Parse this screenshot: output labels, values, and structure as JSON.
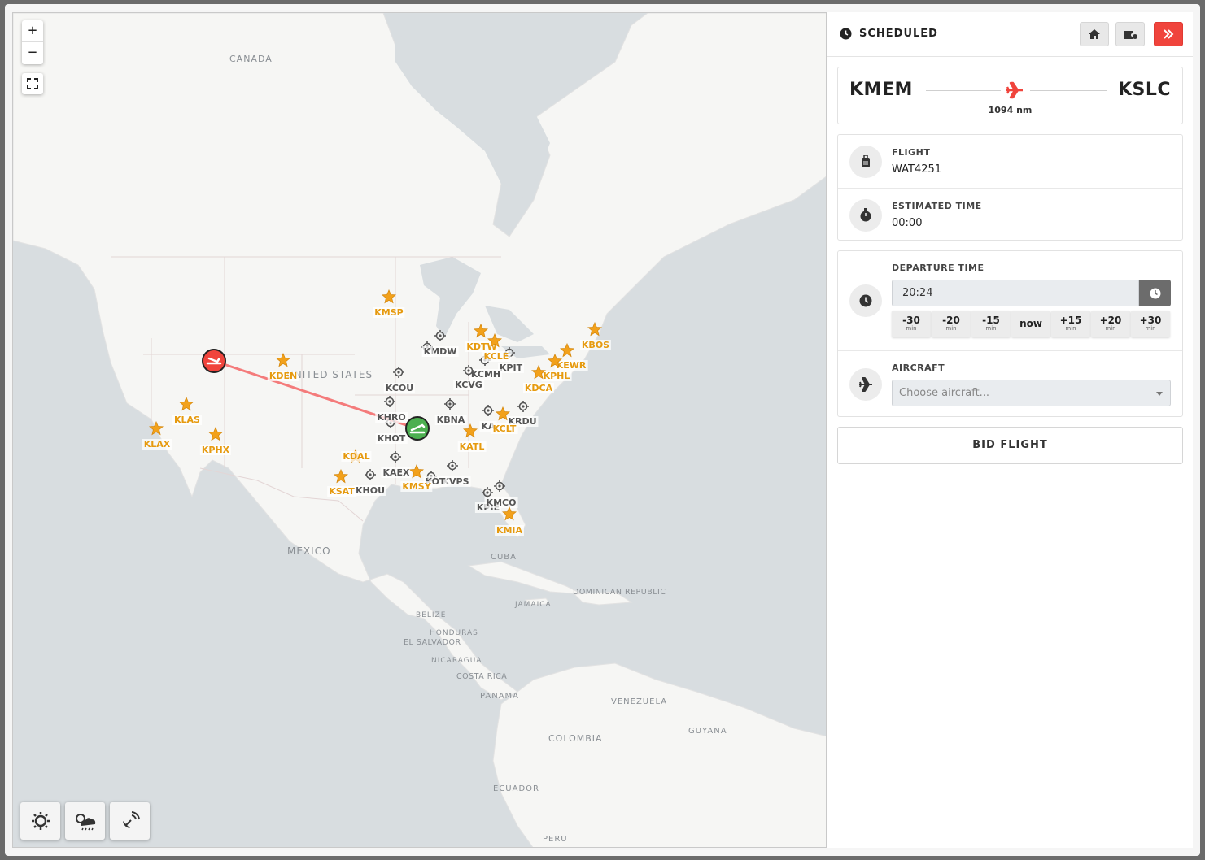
{
  "map": {
    "zoom_in_label": "+",
    "zoom_out_label": "−",
    "region_labels": {
      "canada": "CANADA",
      "united_states": "UNITED STATES",
      "mexico": "MEXICO",
      "cuba": "CUBA",
      "jamaica": "JAMAICA",
      "dominican_republic": "DOMINICAN REPUBLIC",
      "belize": "BELIZE",
      "honduras": "HONDURAS",
      "el_salvador": "EL SALVADOR",
      "nicaragua": "NICARAGUA",
      "costa_rica": "COSTA RICA",
      "panama": "PANAMA",
      "venezuela": "VENEZUELA",
      "colombia": "COLOMBIA",
      "guyana": "GUYANA",
      "ecuador": "ECUADOR",
      "peru": "PERU"
    },
    "airports_starred": [
      "KMSP",
      "KDTW",
      "KCLE",
      "KBOS",
      "KEWR",
      "KPHL",
      "KDCA",
      "KDEN",
      "KLAS",
      "KLAX",
      "KPHX",
      "KDAL",
      "KSAT",
      "KMSY",
      "KATL",
      "KCLT",
      "KMIA"
    ],
    "airports_other": [
      "KMDW",
      "KPIT",
      "KCMH",
      "KCVG",
      "KCOU",
      "KBNA",
      "KRDU",
      "KHOT",
      "KAEX",
      "KHOU",
      "KVPS",
      "KPIE",
      "KMCO"
    ],
    "extra_labels": [
      "K",
      "KHRO",
      "KA",
      "KOT"
    ],
    "tool_icons": [
      "day-night-icon",
      "weather-radar-icon",
      "satellite-icon"
    ]
  },
  "panel": {
    "status": "SCHEDULED",
    "header_buttons": [
      "home-icon",
      "ticket-icon",
      "collapse-icon"
    ],
    "accent_color": "#f0443c",
    "route": {
      "origin": "KMEM",
      "destination": "KSLC",
      "distance": "1094 nm"
    },
    "flight": {
      "label": "FLIGHT",
      "value": "WAT4251"
    },
    "estimated_time": {
      "label": "ESTIMATED TIME",
      "value": "00:00"
    },
    "departure_time": {
      "label": "DEPARTURE TIME",
      "value": "20:24",
      "adjust": [
        {
          "value": "-30",
          "unit": "min"
        },
        {
          "value": "-20",
          "unit": "min"
        },
        {
          "value": "-15",
          "unit": "min"
        },
        {
          "value": "now",
          "unit": ""
        },
        {
          "value": "+15",
          "unit": "min"
        },
        {
          "value": "+20",
          "unit": "min"
        },
        {
          "value": "+30",
          "unit": "min"
        }
      ]
    },
    "aircraft": {
      "label": "AIRCRAFT",
      "placeholder": "Choose aircraft..."
    },
    "bid_label": "BID FLIGHT"
  }
}
